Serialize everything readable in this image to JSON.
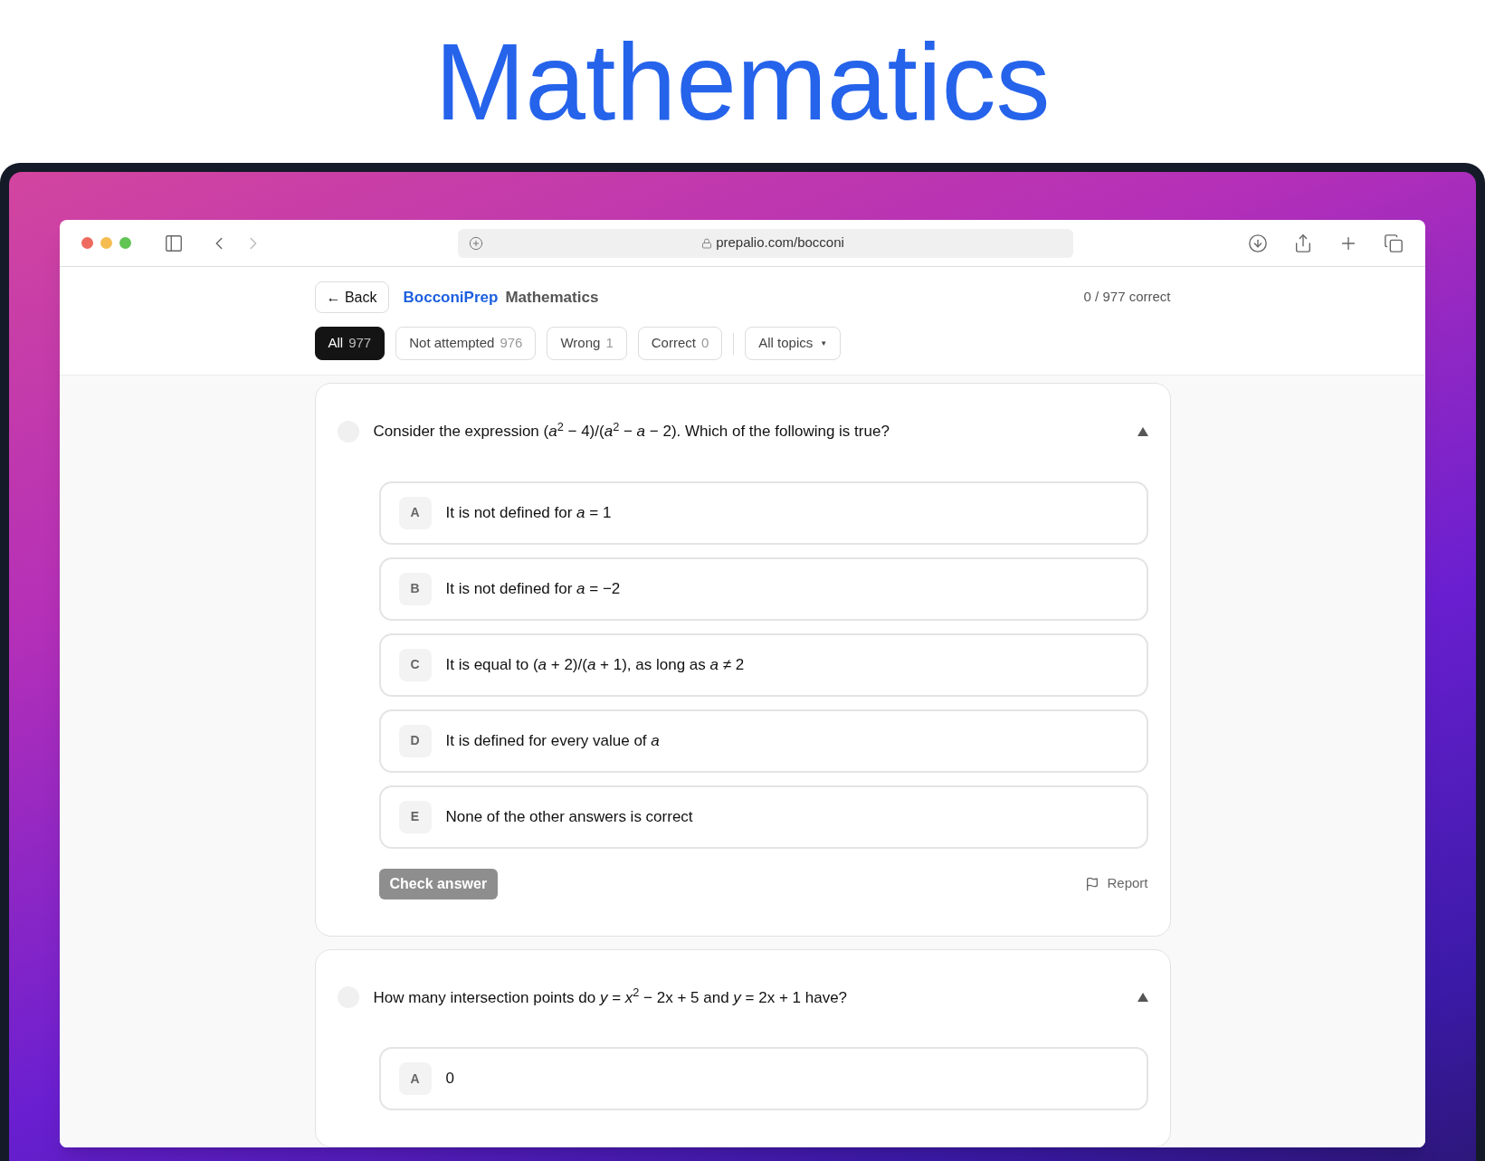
{
  "heading": "Mathematics",
  "browser": {
    "url": "prepalio.com/bocconi"
  },
  "header": {
    "back": "← Back",
    "brand": "BocconiPrep",
    "subject": "Mathematics",
    "score": "0 / 977 correct"
  },
  "filters": [
    {
      "label": "All",
      "count": "977",
      "selected": true
    },
    {
      "label": "Not attempted",
      "count": "976",
      "selected": false
    },
    {
      "label": "Wrong",
      "count": "1",
      "selected": false
    },
    {
      "label": "Correct",
      "count": "0",
      "selected": false
    }
  ],
  "topics": {
    "label": "All topics",
    "caret": "▼"
  },
  "questions": [
    {
      "text": "Consider the expression (*a*$^{2}$ − 4)/(*a*$^{2}$ − *a* − 2). Which of the following is true?",
      "expanded": true,
      "options": [
        {
          "letter": "A",
          "text": "It is not defined for *a* = 1"
        },
        {
          "letter": "B",
          "text": "It is not defined for *a* = −2"
        },
        {
          "letter": "C",
          "text": "It is equal to (*a* + 2)/(*a* + 1), as long as *a* ≠ 2"
        },
        {
          "letter": "D",
          "text": "It is defined for every value of *a*"
        },
        {
          "letter": "E",
          "text": "None of the other answers is correct"
        }
      ],
      "check": {
        "label": "Check answer",
        "disabled": true
      },
      "report": "Report"
    },
    {
      "text": "How many intersection points do *y* = *x*$^{2}$ − 2x + 5 and *y* = 2x + 1 have?",
      "expanded": true,
      "options": [
        {
          "letter": "A",
          "text": "0"
        }
      ]
    }
  ]
}
